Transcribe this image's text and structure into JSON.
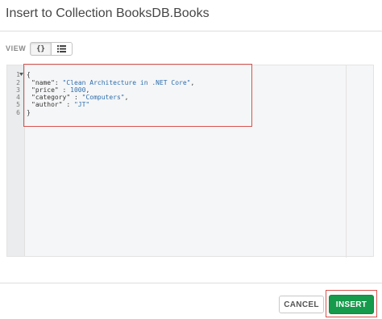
{
  "dialog": {
    "title": "Insert to Collection BooksDB.Books"
  },
  "view": {
    "label": "VIEW",
    "json_toggle_label": "{}",
    "selected": "json"
  },
  "editor": {
    "line_numbers": [
      "1",
      "2",
      "3",
      "4",
      "5",
      "6"
    ],
    "lines": [
      {
        "text": "{"
      },
      {
        "key": "\"name\"",
        "sep": ": ",
        "value": "\"Clean Architecture in .NET Core\"",
        "end": ","
      },
      {
        "key": "\"price\"",
        "sep": " : ",
        "value": "1000",
        "end": ","
      },
      {
        "key": "\"category\"",
        "sep": " : ",
        "value": "\"Computers\"",
        "end": ","
      },
      {
        "key": "\"author\"",
        "sep": " : ",
        "value": "\"JT\"",
        "end": ""
      },
      {
        "text": "}"
      }
    ]
  },
  "footer": {
    "cancel_label": "CANCEL",
    "insert_label": "INSERT"
  },
  "colors": {
    "insert_button": "#169a4b",
    "highlight_border": "#d9534f",
    "string_value": "#2e6fae"
  }
}
